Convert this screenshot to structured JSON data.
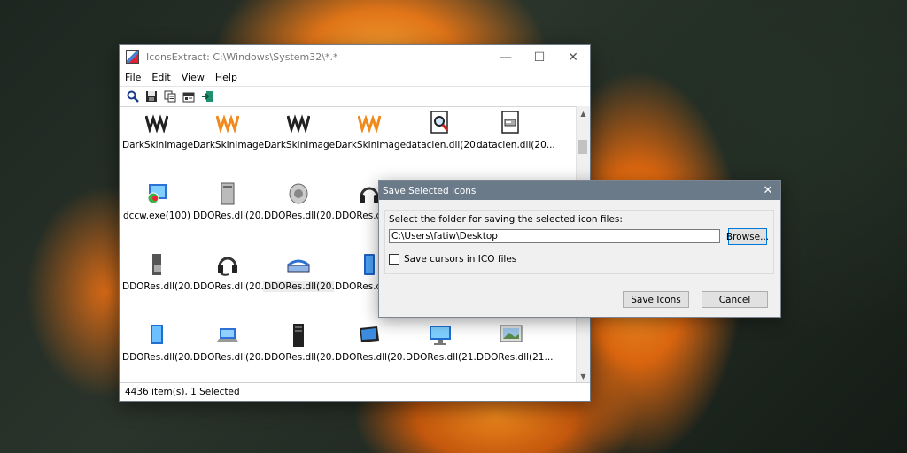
{
  "main_window": {
    "title": "IconsExtract:   C:\\Windows\\System32\\*.*",
    "menu": [
      "File",
      "Edit",
      "View",
      "Help"
    ],
    "toolbar_icons": [
      "search-icon",
      "save-icon",
      "copy-icon",
      "properties-icon",
      "exit-icon"
    ],
    "status": "4436 item(s), 1 Selected",
    "rows": [
      [
        {
          "label": "DarkSkinImage...",
          "icon": "waves-dark-icon"
        },
        {
          "label": "DarkSkinImage...",
          "icon": "waves-orange-icon"
        },
        {
          "label": "DarkSkinImage...",
          "icon": "waves-dark-icon"
        },
        {
          "label": "DarkSkinImage...",
          "icon": "waves-orange-icon"
        },
        {
          "label": "dataclen.dll(20...",
          "icon": "disk-magnifier-icon"
        },
        {
          "label": "dataclen.dll(20...",
          "icon": "disk-drive-icon"
        }
      ],
      [
        {
          "label": "dccw.exe(100)",
          "icon": "color-calibration-icon"
        },
        {
          "label": "DDORes.dll(20...",
          "icon": "pc-tower-icon"
        },
        {
          "label": "DDORes.dll(20...",
          "icon": "speaker-icon"
        },
        {
          "label": "DDORes.dll(20...",
          "icon": "headphones-icon"
        }
      ],
      [
        {
          "label": "DDORes.dll(20...",
          "icon": "audio-device-icon"
        },
        {
          "label": "DDORes.dll(20...",
          "icon": "headset-icon"
        },
        {
          "label": "DDORes.dll(20...",
          "icon": "scanner-icon",
          "selected": true
        },
        {
          "label": "DDORes.dll(20...",
          "icon": "tablet-icon"
        }
      ],
      [
        {
          "label": "DDORes.dll(20...",
          "icon": "monitor-icon"
        },
        {
          "label": "DDORes.dll(20...",
          "icon": "laptop-icon"
        },
        {
          "label": "DDORes.dll(20...",
          "icon": "server-icon"
        },
        {
          "label": "DDORes.dll(20...",
          "icon": "tablet-pc-icon"
        },
        {
          "label": "DDORes.dll(21...",
          "icon": "display-icon"
        },
        {
          "label": "DDORes.dll(21...",
          "icon": "picture-frame-icon"
        }
      ]
    ]
  },
  "dialog": {
    "title": "Save Selected Icons",
    "prompt": "Select the folder for saving the selected icon files:",
    "path_value": "C:\\Users\\fatiw\\Desktop",
    "browse_label": "Browse...",
    "checkbox_label": "Save cursors in ICO files",
    "checkbox_checked": false,
    "save_label": "Save Icons",
    "cancel_label": "Cancel"
  }
}
